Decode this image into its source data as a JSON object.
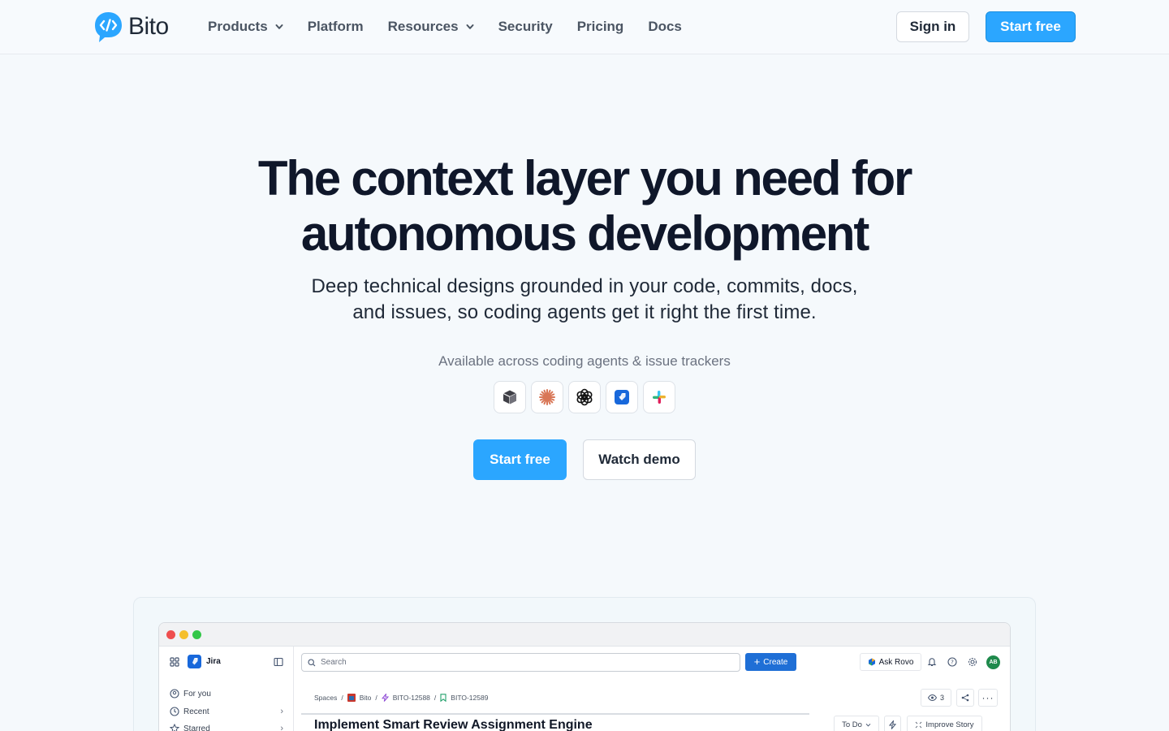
{
  "brand": {
    "name": "Bito",
    "accent": "#2ba6ff"
  },
  "nav": {
    "items": [
      {
        "label": "Products",
        "has_dropdown": true
      },
      {
        "label": "Platform",
        "has_dropdown": false
      },
      {
        "label": "Resources",
        "has_dropdown": true
      },
      {
        "label": "Security",
        "has_dropdown": false
      },
      {
        "label": "Pricing",
        "has_dropdown": false
      },
      {
        "label": "Docs",
        "has_dropdown": false
      }
    ],
    "sign_in": "Sign in",
    "start_free": "Start free"
  },
  "hero": {
    "title_line1": "The context layer you need for",
    "title_line2": "autonomous development",
    "subtitle_line1": "Deep technical designs grounded in your code, commits, docs,",
    "subtitle_line2": "and issues, so coding agents get it right the first time.",
    "available": "Available across coding agents & issue trackers",
    "agents": [
      "cube-icon",
      "claude-icon",
      "openai-icon",
      "jira-icon",
      "slack-icon"
    ],
    "start_free": "Start free",
    "watch_demo": "Watch demo"
  },
  "jira": {
    "app_name": "Jira",
    "sidebar": [
      {
        "label": "For you",
        "icon": "user-circle-icon",
        "chevron": false
      },
      {
        "label": "Recent",
        "icon": "clock-icon",
        "chevron": true
      },
      {
        "label": "Starred",
        "icon": "star-icon",
        "chevron": true
      }
    ],
    "search_placeholder": "Search",
    "create": "Create",
    "ask_rovo": "Ask Rovo",
    "avatar": "AB",
    "breadcrumb": [
      "Spaces",
      "Bito",
      "BITO-12588",
      "BITO-12589"
    ],
    "watchers": "3",
    "issue_title": "Implement Smart Review Assignment Engine",
    "status": "To Do",
    "improve_story": "Improve Story"
  }
}
